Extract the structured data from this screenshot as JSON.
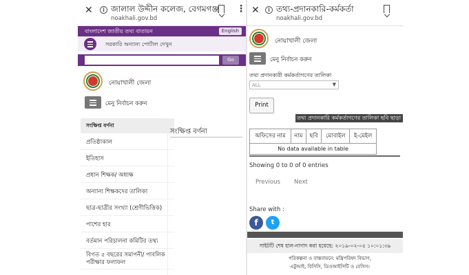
{
  "left_panel": {
    "browser": {
      "title": "জালাল উদ্দীন কলেজ, বেগমগঞ্জ",
      "url": "noakhali.gov.bd",
      "close_glyph": "✕",
      "menu_glyph": "⋮",
      "info_glyph": "i"
    },
    "top_bar": {
      "portal_name": "বাংলাদেশ জাতীয় তথ্য বাতায়ন",
      "language_button": "English"
    },
    "other_portals": "সরকারি অন্যান্য পোর্টাল দেখুন",
    "search": {
      "placeholder": "",
      "go_button": "Go"
    },
    "district_name": "নোয়াখালী জেলা",
    "menu_select_label": "মেনু নির্বাচন করুন",
    "sidebar": {
      "heading": "সংক্ষিপ্ত বর্ণনা",
      "items": [
        "প্রতিষ্ঠাকাল",
        "ইতিহাস",
        "প্রধান শিক্ষক/ অধ্যক্ষ",
        "অন্যান্য শিক্ষকদের তালিকা",
        "ছাত্র-ছাত্রীর সংখ্যা (শ্রেণীভিত্তিক)",
        "পাশের হার",
        "বর্তমান পরিচালনা কমিটির তথ্য",
        "বিগত ৫ বছরের সমাপনী/ পাবলিক পরীক্ষার ফলাফল"
      ]
    },
    "content_title": "সংক্ষিপ্ত বর্ণনা"
  },
  "right_panel": {
    "browser": {
      "title": "তথ্য-প্রদানকারি-কর্মকর্তা",
      "url": "noakhali.gov.bd",
      "close_glyph": "✕",
      "info_glyph": "i"
    },
    "district_name": "নোয়াখালী জেলা",
    "menu_select_label": "মেনু নির্বাচন করুন",
    "list_label": "তথ্য প্রদানকারী কর্মকর্তাগণের তালিকা",
    "select_value": "ALL",
    "print_button": "Print",
    "marquee_text": "তথ্য প্রদানকারি কর্মকর্তাগণের তালিকা ছবি ছাড়া",
    "table": {
      "headers": [
        "অফিসের নাম",
        "নাম",
        "ছবি",
        "মোবাইল",
        "ই-মেইল"
      ],
      "empty_message": "No data available in table"
    },
    "showing": "Showing 0 to 0 of 0 entries",
    "pager": {
      "previous": "Previous",
      "next": "Next"
    },
    "share_label": "Share with :",
    "social": {
      "facebook_glyph": "f",
      "twitter_glyph": "t"
    },
    "last_updated": "সাইটটি শেষ হাল-নাগাদ করা হয়েছে: ২০১৯-০২-০৫ ১০:০১:৩৯",
    "credit_line1": "পরিকল্পনা ও বাস্তবায়নে: মন্ত্রিপরিষদ বিভাগ,",
    "credit_line2": "এটুআই, বিসিসি, ডিওআইসিটি ও বেসিস।"
  },
  "colors": {
    "brand_purple": "#6a2f86",
    "facebook": "#3b5998",
    "twitter": "#1da1f2"
  }
}
